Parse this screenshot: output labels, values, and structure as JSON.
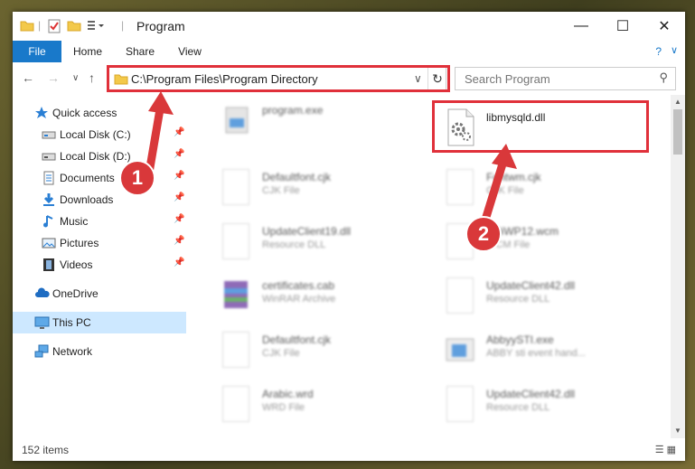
{
  "window": {
    "title": "Program"
  },
  "ribbon": {
    "tabs": [
      "File",
      "Home",
      "Share",
      "View"
    ]
  },
  "address": {
    "path": "C:\\Program Files\\Program Directory"
  },
  "search": {
    "placeholder": "Search Program"
  },
  "nav": {
    "items": [
      {
        "label": "Quick access",
        "icon": "star-icon"
      },
      {
        "label": "Local Disk (C:)",
        "icon": "drive-icon"
      },
      {
        "label": "Local Disk (D:)",
        "icon": "drive-icon"
      },
      {
        "label": "Documents",
        "icon": "documents-icon"
      },
      {
        "label": "Downloads",
        "icon": "downloads-icon"
      },
      {
        "label": "Music",
        "icon": "music-icon"
      },
      {
        "label": "Pictures",
        "icon": "pictures-icon"
      },
      {
        "label": "Videos",
        "icon": "videos-icon"
      },
      {
        "label": "OneDrive",
        "icon": "cloud-icon"
      },
      {
        "label": "This PC",
        "icon": "pc-icon"
      },
      {
        "label": "Network",
        "icon": "network-icon"
      }
    ]
  },
  "files": [
    {
      "name": "program.exe",
      "type": ""
    },
    {
      "name": "libmysqld.dll",
      "type": ""
    },
    {
      "name": "Defaultfont.cjk",
      "type": "CJK File"
    },
    {
      "name": "Fontwm.cjk",
      "type": "CJK File"
    },
    {
      "name": "UpdateClient19.dll",
      "type": "Resource DLL"
    },
    {
      "name": "fo0iWP12.wcm",
      "type": "WCM File"
    },
    {
      "name": "certificates.cab",
      "type": "WinRAR Archive"
    },
    {
      "name": "UpdateClient42.dll",
      "type": "Resource DLL"
    },
    {
      "name": "Defaultfont.cjk",
      "type": "CJK File"
    },
    {
      "name": "AbbyySTI.exe",
      "type": "ABBY sti event hand..."
    },
    {
      "name": "Arabic.wrd",
      "type": "WRD File"
    },
    {
      "name": "UpdateClient42.dll",
      "type": "Resource DLL"
    }
  ],
  "status": {
    "count": "152 items"
  },
  "annotations": {
    "badge1": "1",
    "badge2": "2"
  },
  "colors": {
    "accent": "#1979ca",
    "highlight": "#e0303a",
    "badge": "#d9383a",
    "selected": "#cde8ff"
  }
}
